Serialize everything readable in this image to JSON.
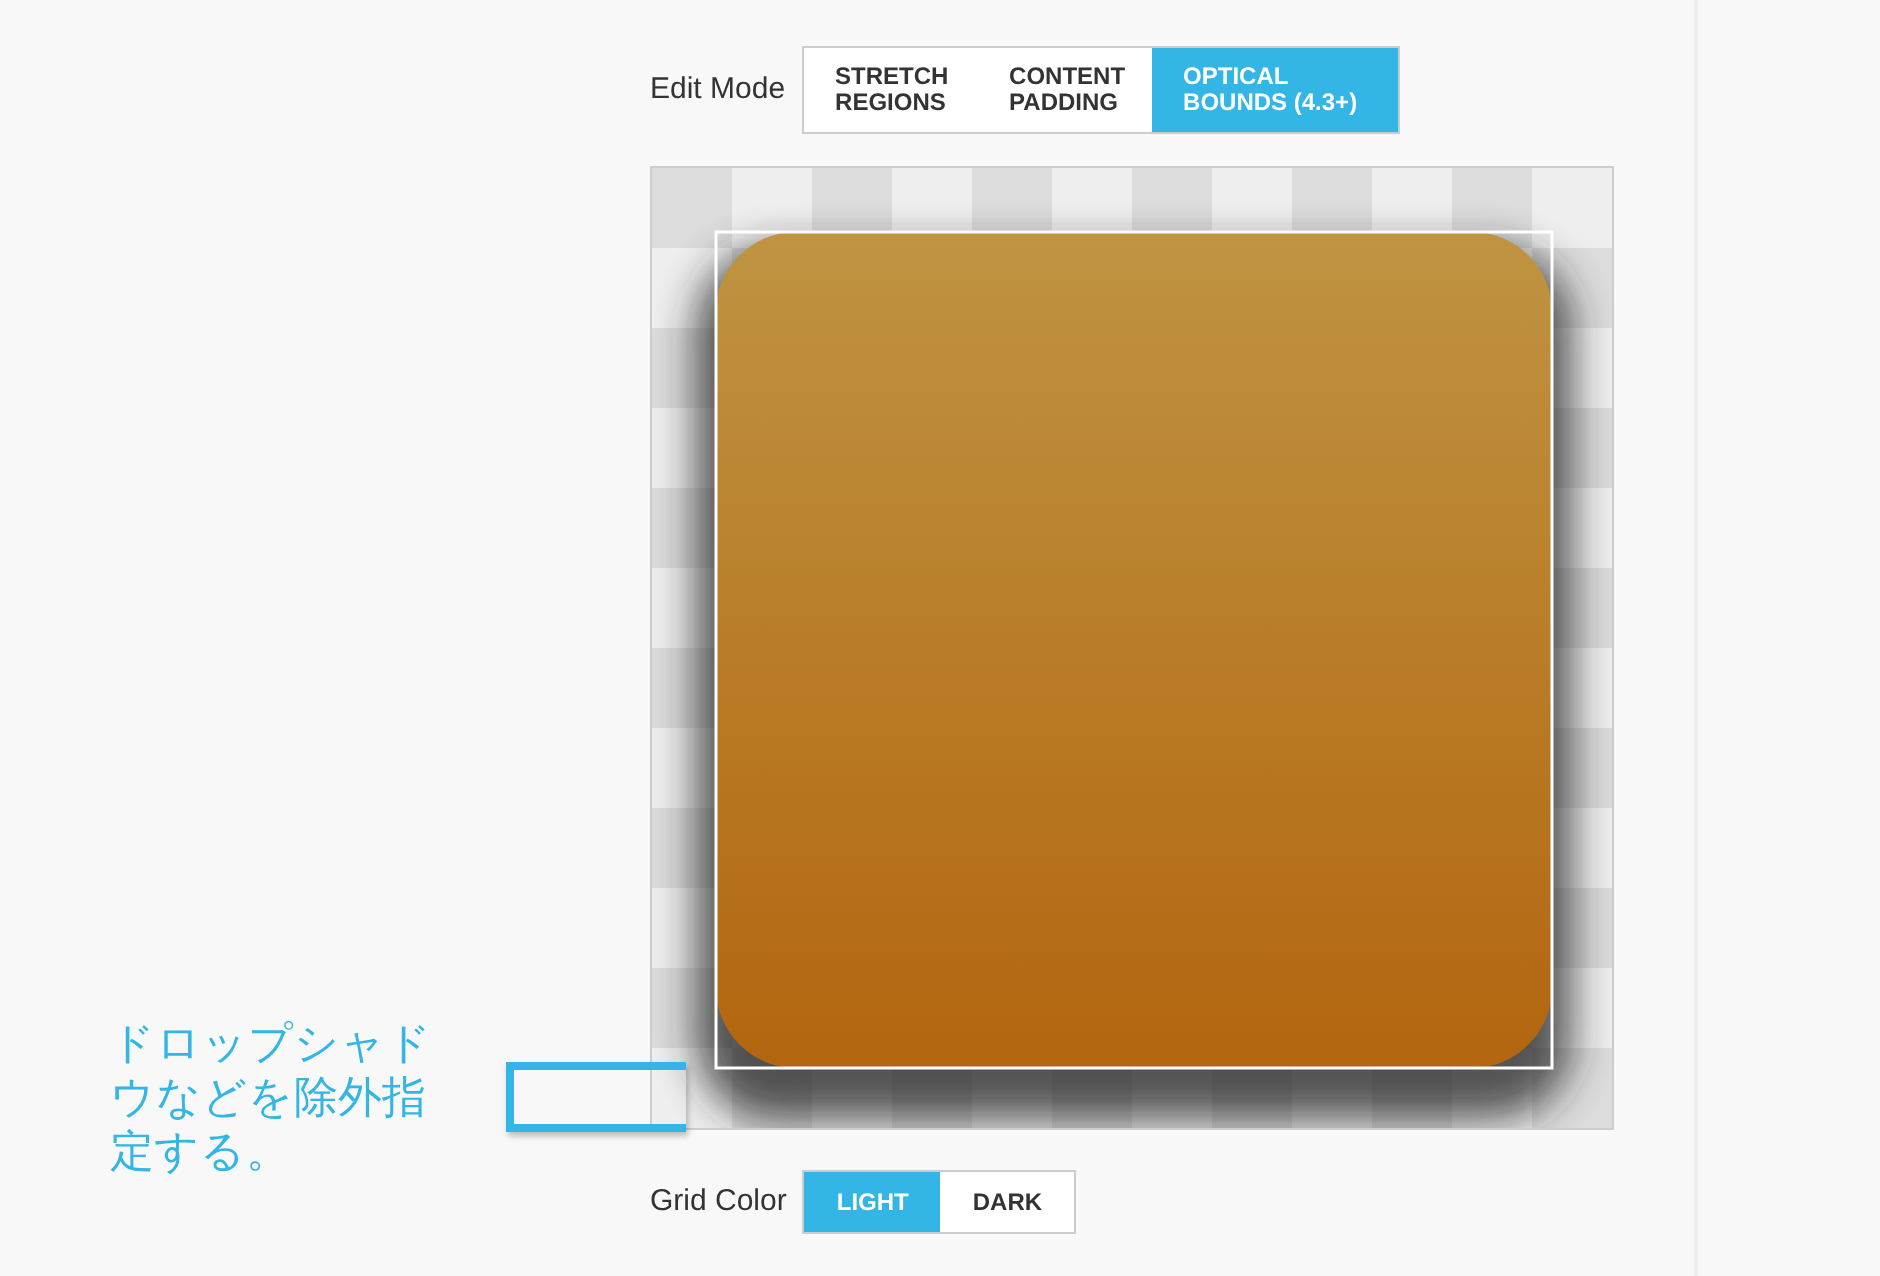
{
  "edit_mode": {
    "label": "Edit Mode",
    "options": [
      {
        "label": "STRETCH REGIONS",
        "selected": false
      },
      {
        "label": "CONTENT PADDING",
        "selected": false
      },
      {
        "label": "OPTICAL BOUNDS (4.3+)",
        "selected": true
      }
    ]
  },
  "annotation": {
    "text": "ドロップシャドウなどを除外指定する。"
  },
  "grid_color": {
    "label": "Grid Color",
    "options": [
      {
        "label": "LIGHT",
        "selected": true
      },
      {
        "label": "DARK",
        "selected": false
      }
    ]
  }
}
